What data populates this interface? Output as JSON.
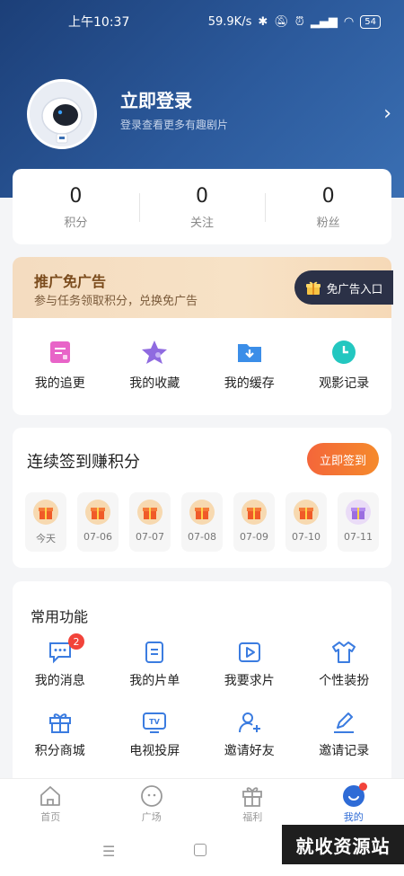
{
  "status_bar": {
    "time": "上午10:37",
    "speed": "59.9K/s",
    "battery": "54"
  },
  "profile": {
    "login_title": "立即登录",
    "login_subtitle": "登录查看更多有趣剧片"
  },
  "stats": [
    {
      "value": "0",
      "label": "积分"
    },
    {
      "value": "0",
      "label": "关注"
    },
    {
      "value": "0",
      "label": "粉丝"
    }
  ],
  "promo": {
    "title": "推广免广告",
    "subtitle": "参与任务领取积分，兑换免广告",
    "button": "免广告入口"
  },
  "quick_actions": [
    {
      "label": "我的追更",
      "icon": "follow-update-icon",
      "color": "#e864c8"
    },
    {
      "label": "我的收藏",
      "icon": "star-icon",
      "color": "#8f6ae0"
    },
    {
      "label": "我的缓存",
      "icon": "download-folder-icon",
      "color": "#3b8ee8"
    },
    {
      "label": "观影记录",
      "icon": "clock-icon",
      "color": "#23c7c0"
    }
  ],
  "signin": {
    "title": "连续签到赚积分",
    "button": "立即签到",
    "days": [
      "今天",
      "07-06",
      "07-07",
      "07-08",
      "07-09",
      "07-10",
      "07-11"
    ]
  },
  "common_functions": {
    "title": "常用功能",
    "items": [
      {
        "label": "我的消息",
        "icon": "message-icon",
        "badge": "2"
      },
      {
        "label": "我的片单",
        "icon": "playlist-icon"
      },
      {
        "label": "我要求片",
        "icon": "play-request-icon"
      },
      {
        "label": "个性装扮",
        "icon": "shirt-icon"
      },
      {
        "label": "积分商城",
        "icon": "gift-box-icon"
      },
      {
        "label": "电视投屏",
        "icon": "tv-icon"
      },
      {
        "label": "邀请好友",
        "icon": "add-friend-icon"
      },
      {
        "label": "邀请记录",
        "icon": "edit-icon"
      }
    ]
  },
  "tabbar": [
    {
      "label": "首页",
      "icon": "home-icon"
    },
    {
      "label": "广场",
      "icon": "square-icon"
    },
    {
      "label": "福利",
      "icon": "gift-icon"
    },
    {
      "label": "我的",
      "icon": "profile-icon",
      "active": true
    }
  ],
  "watermark": "就收资源站",
  "colors": {
    "accent": "#2e6bd6",
    "header": "#1c3f78",
    "signin": "#f4663a",
    "promo_text": "#7a4b1c"
  }
}
